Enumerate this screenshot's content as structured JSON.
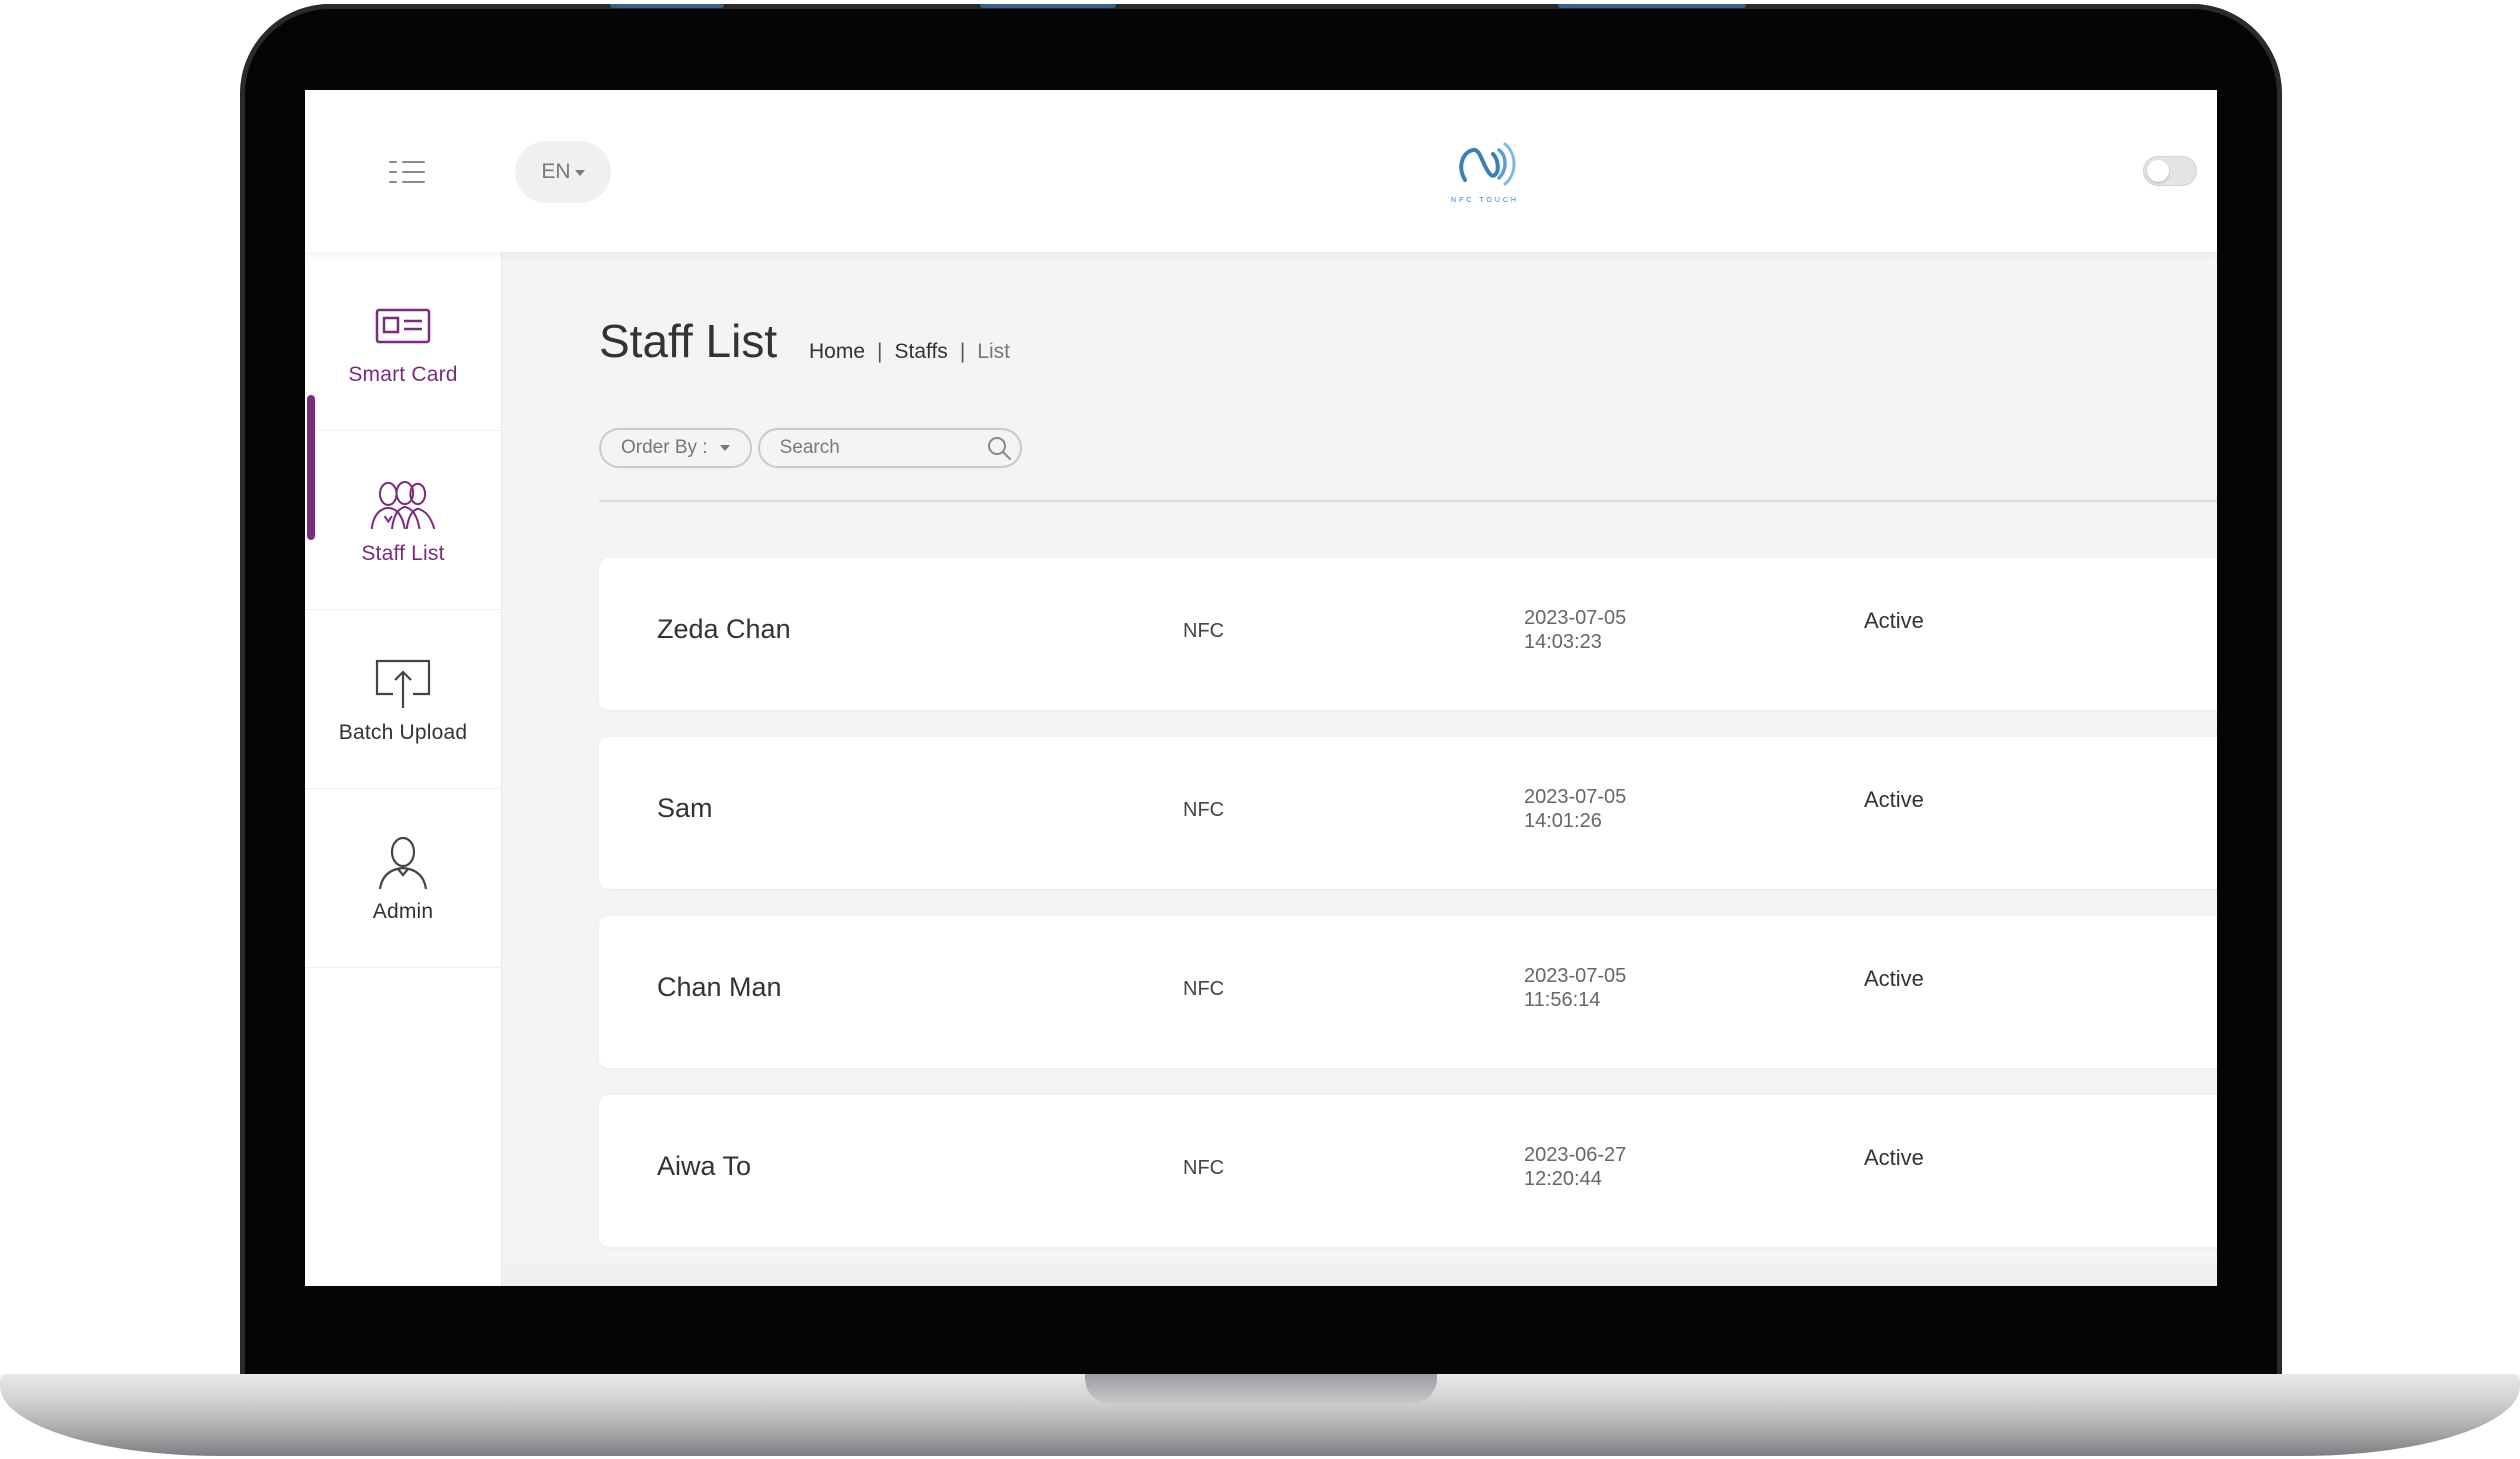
{
  "topbar": {
    "language": "EN",
    "logo_text": "NFC TOUCH"
  },
  "sidebar": {
    "items": [
      {
        "label": "Smart Card",
        "icon": "id-card-icon"
      },
      {
        "label": "Staff List",
        "icon": "staff-group-icon"
      },
      {
        "label": "Batch Upload",
        "icon": "upload-icon"
      },
      {
        "label": "Admin",
        "icon": "user-icon"
      }
    ],
    "active_index": 1,
    "accent_color": "#7b2b7d"
  },
  "page": {
    "title": "Staff List",
    "breadcrumb": [
      "Home",
      "Staffs",
      "List"
    ]
  },
  "filters": {
    "order_by_label": "Order By :",
    "search_placeholder": "Search"
  },
  "staff": [
    {
      "name": "Zeda Chan",
      "type": "NFC",
      "date": "2023-07-05",
      "time": "14:03:23",
      "status": "Active"
    },
    {
      "name": "Sam",
      "type": "NFC",
      "date": "2023-07-05",
      "time": "14:01:26",
      "status": "Active"
    },
    {
      "name": "Chan Man",
      "type": "NFC",
      "date": "2023-07-05",
      "time": "11:56:14",
      "status": "Active"
    },
    {
      "name": "Aiwa To",
      "type": "NFC",
      "date": "2023-06-27",
      "time": "12:20:44",
      "status": "Active"
    }
  ]
}
